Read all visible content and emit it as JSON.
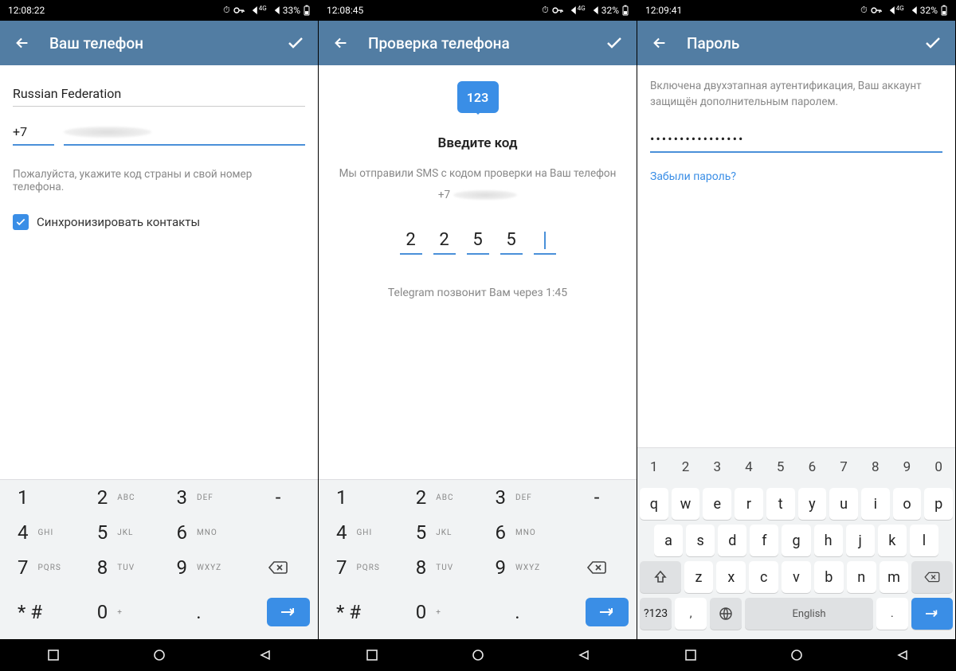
{
  "status_icons": {
    "alarm": "⏰",
    "key": "⚿",
    "battery": "▯"
  },
  "screen1": {
    "status": {
      "time": "12:08:22",
      "signal_label": "4G",
      "battery_pct": "33%"
    },
    "appbar": {
      "title": "Ваш телефон"
    },
    "country": "Russian Federation",
    "country_code": "+7",
    "phone_value": "",
    "help_text": "Пожалуйста, укажите код страны и свой номер телефона.",
    "sync_label": "Синхронизировать контакты",
    "sync_checked": true,
    "keypad": {
      "rows": [
        [
          {
            "d": "1",
            "l": ""
          },
          {
            "d": "2",
            "l": "ABC"
          },
          {
            "d": "3",
            "l": "DEF"
          },
          {
            "d": "-",
            "l": ""
          }
        ],
        [
          {
            "d": "4",
            "l": "GHI"
          },
          {
            "d": "5",
            "l": "JKL"
          },
          {
            "d": "6",
            "l": "MNO"
          },
          {
            "d": "",
            "l": ""
          }
        ],
        [
          {
            "d": "7",
            "l": "PQRS"
          },
          {
            "d": "8",
            "l": "TUV"
          },
          {
            "d": "9",
            "l": "WXYZ"
          },
          {
            "d": "⌫",
            "l": ""
          }
        ],
        [
          {
            "d": "* #",
            "l": ""
          },
          {
            "d": "0",
            "l": "+"
          },
          {
            "d": ".",
            "l": ""
          },
          {
            "d": "↵",
            "l": ""
          }
        ]
      ]
    }
  },
  "screen2": {
    "status": {
      "time": "12:08:45",
      "signal_label": "4G",
      "battery_pct": "32%"
    },
    "appbar": {
      "title": "Проверка телефона"
    },
    "bubble_text": "123",
    "enter_code_title": "Введите код",
    "sms_text": "Мы отправили SMS с кодом проверки на Ваш телефон",
    "sms_prefix": "+7",
    "code_digits": [
      "2",
      "2",
      "5",
      "5",
      ""
    ],
    "call_text": "Telegram позвонит Вам через 1:45",
    "keypad": {
      "rows": [
        [
          {
            "d": "1",
            "l": ""
          },
          {
            "d": "2",
            "l": "ABC"
          },
          {
            "d": "3",
            "l": "DEF"
          },
          {
            "d": "-",
            "l": ""
          }
        ],
        [
          {
            "d": "4",
            "l": "GHI"
          },
          {
            "d": "5",
            "l": "JKL"
          },
          {
            "d": "6",
            "l": "MNO"
          },
          {
            "d": "",
            "l": ""
          }
        ],
        [
          {
            "d": "7",
            "l": "PQRS"
          },
          {
            "d": "8",
            "l": "TUV"
          },
          {
            "d": "9",
            "l": "WXYZ"
          },
          {
            "d": "⌫",
            "l": ""
          }
        ],
        [
          {
            "d": "* #",
            "l": ""
          },
          {
            "d": "0",
            "l": "+"
          },
          {
            "d": ".",
            "l": ""
          },
          {
            "d": "↵",
            "l": ""
          }
        ]
      ]
    }
  },
  "screen3": {
    "status": {
      "time": "12:09:41",
      "signal_label": "4G",
      "battery_pct": "32%"
    },
    "appbar": {
      "title": "Пароль"
    },
    "info_text": "Включена двухэтапная аутентификация, Ваш аккаунт защищён дополнительным паролем.",
    "password_mask": "••••••••••••••••",
    "forgot_link": "Забыли пароль?",
    "keyboard": {
      "row_nums": [
        "1",
        "2",
        "3",
        "4",
        "5",
        "6",
        "7",
        "8",
        "9",
        "0"
      ],
      "row1": [
        "q",
        "w",
        "e",
        "r",
        "t",
        "y",
        "u",
        "i",
        "o",
        "p"
      ],
      "row2": [
        "a",
        "s",
        "d",
        "f",
        "g",
        "h",
        "j",
        "k",
        "l"
      ],
      "row3": [
        "z",
        "x",
        "c",
        "v",
        "b",
        "n",
        "m"
      ],
      "symbols_key": "?123",
      "comma_key": ",",
      "space_label": "English",
      "period_key": "."
    }
  }
}
